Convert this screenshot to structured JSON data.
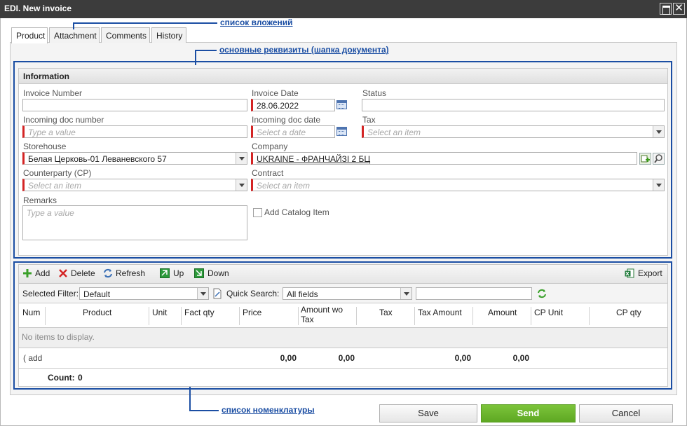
{
  "window": {
    "title": "EDI. New invoice",
    "close_glyph": "✕"
  },
  "tabs": [
    {
      "label": "Product",
      "active": true
    },
    {
      "label": "Attachment",
      "active": false
    },
    {
      "label": "Comments",
      "active": false
    },
    {
      "label": "History",
      "active": false
    }
  ],
  "annotations": {
    "attachments": "список вложений",
    "header": "основные реквизиты (шапка документа)",
    "items": "список номенклатуры",
    "color": "#1b4ea3"
  },
  "info": {
    "title": "Information",
    "invoice_number": {
      "label": "Invoice Number",
      "value": ""
    },
    "invoice_date": {
      "label": "Invoice Date",
      "value": "28.06.2022"
    },
    "status": {
      "label": "Status",
      "value": ""
    },
    "incoming_doc_number": {
      "label": "Incoming doc number",
      "placeholder": "Type a value"
    },
    "incoming_doc_date": {
      "label": "Incoming doc date",
      "placeholder": "Select a date"
    },
    "tax": {
      "label": "Tax",
      "placeholder": "Select an item"
    },
    "storehouse": {
      "label": "Storehouse",
      "value": "Белая Церковь-01 Леваневского 57"
    },
    "company": {
      "label": "Company",
      "value": "UKRAINE - ФРАНЧАЙЗІ 2 БЦ"
    },
    "counterparty": {
      "label": "Counterparty (CP)",
      "placeholder": "Select an item"
    },
    "contract": {
      "label": "Contract",
      "placeholder": "Select an item"
    },
    "remarks": {
      "label": "Remarks",
      "placeholder": "Type a value"
    },
    "add_catalog_item": {
      "label": "Add Catalog Item",
      "checked": false
    }
  },
  "toolbar": {
    "add": "Add",
    "delete": "Delete",
    "refresh": "Refresh",
    "up": "Up",
    "down": "Down",
    "export": "Export"
  },
  "filter": {
    "selected_filter_label": "Selected Filter:",
    "selected_filter_value": "Default",
    "quick_search_label": "Quick Search:",
    "quick_search_scope": "All fields",
    "quick_search_value": ""
  },
  "grid": {
    "columns": [
      "Num",
      "Product",
      "Unit",
      "Fact qty",
      "Price",
      "Amount wo",
      "Tax",
      "Tax Amount",
      "Amount",
      "CP Unit",
      "CP qty"
    ],
    "column_amount_wo_line2": "Tax",
    "empty_text": "No items to display.",
    "summary": {
      "add_link": "( add",
      "price_total": "0,00",
      "amount_wo_tax_total": "0,00",
      "tax_amount_total": "0,00",
      "amount_total": "0,00"
    },
    "count_label": "Count:",
    "count_value": "0"
  },
  "footer": {
    "save": "Save",
    "send": "Send",
    "cancel": "Cancel"
  },
  "colors": {
    "required": "#d42424",
    "send": "#6bb62e",
    "titlebar": "#3c3c3c"
  }
}
